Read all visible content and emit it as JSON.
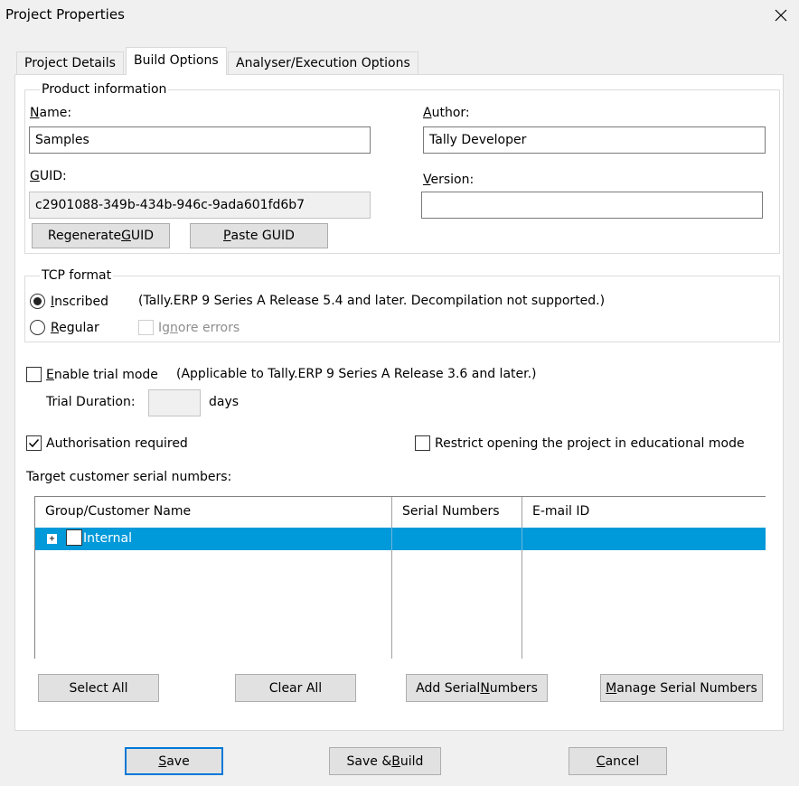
{
  "window": {
    "title": "Project Properties",
    "close_glyph": "✕"
  },
  "tabs": [
    {
      "label": "Project Details",
      "active": false
    },
    {
      "label": "Build Options",
      "active": true
    },
    {
      "label": "Analyser/Execution Options",
      "active": false
    }
  ],
  "product_info": {
    "legend": "Product information",
    "name_label_u": "N",
    "name_label_rest": "ame:",
    "name_value": "Samples",
    "author_label_u": "A",
    "author_label_rest": "uthor:",
    "author_value": "Tally Developer",
    "guid_label_u": "G",
    "guid_label_rest": "UID:",
    "guid_value": "c2901088-349b-434b-946c-9ada601fd6b7",
    "version_label_u": "V",
    "version_label_rest": "ersion:",
    "version_value": "",
    "regenerate_pre": "Regenerate ",
    "regenerate_u": "G",
    "regenerate_post": "UID",
    "paste_u": "P",
    "paste_post": "aste GUID"
  },
  "tcp_format": {
    "legend": "TCP format",
    "inscribed_u": "I",
    "inscribed_rest": "nscribed",
    "inscribed_selected": true,
    "inscribed_note": "(Tally.ERP 9 Series A Release 5.4 and later. Decompilation not supported.)",
    "regular_u": "R",
    "regular_rest": "egular",
    "regular_selected": false,
    "ignore_pre": "Ig",
    "ignore_u": "n",
    "ignore_post": "ore errors",
    "ignore_checked": false
  },
  "trial": {
    "enable_u": "E",
    "enable_rest": "nable trial mode",
    "enable_checked": false,
    "note": "(Applicable to Tally.ERP 9 Series A Release 3.6 and later.)",
    "duration_label": "Trial Duration:",
    "duration_value": "",
    "days_label": "days"
  },
  "authorisation": {
    "label": "Authorisation required",
    "checked": true
  },
  "restrict": {
    "label": "Restrict opening the project in educational mode",
    "checked": false
  },
  "target": {
    "label": "Target customer serial numbers:",
    "columns": [
      "Group/Customer Name",
      "Serial Numbers",
      "E-mail ID"
    ],
    "rows": [
      {
        "name": "Internal",
        "serial": "",
        "email": "",
        "expander": "+",
        "checked": false
      }
    ]
  },
  "grid_buttons": {
    "select_all": "Select All",
    "clear_all": "Clear All",
    "add_pre": "Add Serial ",
    "add_u": "N",
    "add_post": "umbers",
    "manage_u": "M",
    "manage_post": "anage Serial Numbers"
  },
  "footer": {
    "save_u": "S",
    "save_post": "ave",
    "save_build_pre": "Save & ",
    "save_build_u": "B",
    "save_build_post": "uild",
    "cancel_u": "C",
    "cancel_post": "ancel"
  }
}
